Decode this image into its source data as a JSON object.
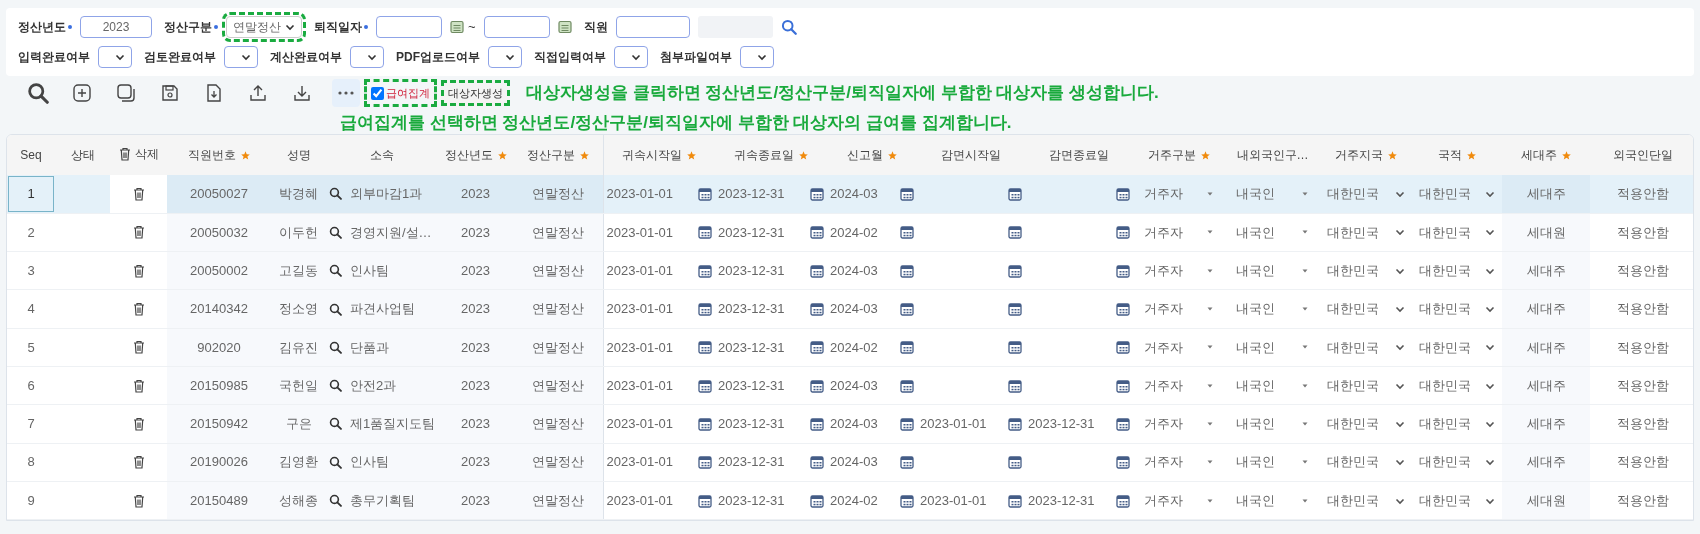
{
  "filters": [
    {
      "label": "정산년도",
      "required": true,
      "kind": "text",
      "value": "2023",
      "highlighted": false
    },
    {
      "label": "정산구분",
      "required": true,
      "kind": "select",
      "value": "연말정산",
      "highlighted": true
    },
    {
      "label": "퇴직일자",
      "required": true,
      "kind": "daterange",
      "separator": "~",
      "highlighted": false
    },
    {
      "label": "직원",
      "required": false,
      "kind": "employee",
      "highlighted": false
    }
  ],
  "status_filters": [
    {
      "label": "입력완료여부"
    },
    {
      "label": "검토완료여부"
    },
    {
      "label": "계산완료여부"
    },
    {
      "label": "PDF업로드여부"
    },
    {
      "label": "직접입력여부"
    },
    {
      "label": "첨부파일여부"
    }
  ],
  "toolbar": {
    "tools": [
      {
        "kind": "search"
      },
      {
        "kind": "add"
      },
      {
        "kind": "copy"
      },
      {
        "kind": "save"
      },
      {
        "kind": "import"
      },
      {
        "kind": "upload"
      },
      {
        "kind": "download"
      },
      {
        "kind": "more"
      }
    ],
    "payroll_sum": {
      "label": "급여집계",
      "checked": true,
      "highlighted": true
    },
    "create_button": {
      "label": "대상자생성",
      "highlighted": true
    }
  },
  "notes": [
    "대상자생성을 클릭하면 정산년도/정산구분/퇴직일자에 부합한 대상자를 생성합니다.",
    "급여집계를 선택하면 정산년도/정산구분/퇴직일자에 부합한 대상자의 급여를 집계합니다."
  ],
  "table": {
    "columns": [
      {
        "label": "Seq",
        "kind": "seq",
        "required": false
      },
      {
        "label": "상태",
        "kind": "status",
        "required": false
      },
      {
        "label": "삭제",
        "kind": "delete",
        "required": false
      },
      {
        "label": "직원번호",
        "kind": "text",
        "required": true
      },
      {
        "label": "성명",
        "kind": "text",
        "required": false
      },
      {
        "label": "소속",
        "kind": "lookup",
        "required": false
      },
      {
        "label": "정산년도",
        "kind": "text",
        "required": true
      },
      {
        "label": "정산구분",
        "kind": "text",
        "required": true
      },
      {
        "label": "귀속시작일",
        "kind": "date",
        "required": true
      },
      {
        "label": "귀속종료일",
        "kind": "date",
        "required": true
      },
      {
        "label": "신고월",
        "kind": "date",
        "required": true
      },
      {
        "label": "감면시작일",
        "kind": "date",
        "required": false
      },
      {
        "label": "감면종료일",
        "kind": "date",
        "required": false
      },
      {
        "label": "거주구분",
        "kind": "select",
        "required": true
      },
      {
        "label": "내외국인구…",
        "kind": "select",
        "required": false
      },
      {
        "label": "거주지국",
        "kind": "combo",
        "required": true
      },
      {
        "label": "국적",
        "kind": "combo",
        "required": true
      },
      {
        "label": "세대주",
        "kind": "shaded",
        "required": true
      },
      {
        "label": "외국인단일",
        "kind": "text",
        "required": false
      }
    ],
    "rows": [
      {
        "selected": true,
        "cells": [
          "1",
          "",
          "",
          "20050027",
          "박경혜",
          "외부마감1과",
          "2023",
          "연말정산",
          "2023-01-01",
          "2023-12-31",
          "2024-03",
          null,
          null,
          "거주자",
          "내국인",
          "대한민국",
          "대한민국",
          "세대주",
          "적용안함"
        ]
      },
      {
        "selected": false,
        "cells": [
          "2",
          "",
          "",
          "20050032",
          "이두헌",
          "경영지원/설…",
          "2023",
          "연말정산",
          "2023-01-01",
          "2023-12-31",
          "2024-02",
          null,
          null,
          "거주자",
          "내국인",
          "대한민국",
          "대한민국",
          "세대원",
          "적용안함"
        ]
      },
      {
        "selected": false,
        "cells": [
          "3",
          "",
          "",
          "20050002",
          "고길동",
          "인사팀",
          "2023",
          "연말정산",
          "2023-01-01",
          "2023-12-31",
          "2024-03",
          null,
          null,
          "거주자",
          "내국인",
          "대한민국",
          "대한민국",
          "세대주",
          "적용안함"
        ]
      },
      {
        "selected": false,
        "cells": [
          "4",
          "",
          "",
          "20140342",
          "정소영",
          "파견사업팀",
          "2023",
          "연말정산",
          "2023-01-01",
          "2023-12-31",
          "2024-03",
          null,
          null,
          "거주자",
          "내국인",
          "대한민국",
          "대한민국",
          "세대주",
          "적용안함"
        ]
      },
      {
        "selected": false,
        "cells": [
          "5",
          "",
          "",
          "902020",
          "김유진",
          "단품과",
          "2023",
          "연말정산",
          "2023-01-01",
          "2023-12-31",
          "2024-02",
          null,
          null,
          "거주자",
          "내국인",
          "대한민국",
          "대한민국",
          "세대주",
          "적용안함"
        ]
      },
      {
        "selected": false,
        "cells": [
          "6",
          "",
          "",
          "20150985",
          "국헌일",
          "안전2과",
          "2023",
          "연말정산",
          "2023-01-01",
          "2023-12-31",
          "2024-03",
          null,
          null,
          "거주자",
          "내국인",
          "대한민국",
          "대한민국",
          "세대주",
          "적용안함"
        ]
      },
      {
        "selected": false,
        "cells": [
          "7",
          "",
          "",
          "20150942",
          "구은",
          "제1품질지도팀",
          "2023",
          "연말정산",
          "2023-01-01",
          "2023-12-31",
          "2024-03",
          "2023-01-01",
          "2023-12-31",
          "거주자",
          "내국인",
          "대한민국",
          "대한민국",
          "세대주",
          "적용안함"
        ]
      },
      {
        "selected": false,
        "cells": [
          "8",
          "",
          "",
          "20190026",
          "김영환",
          "인사팀",
          "2023",
          "연말정산",
          "2023-01-01",
          "2023-12-31",
          "2024-03",
          null,
          null,
          "거주자",
          "내국인",
          "대한민국",
          "대한민국",
          "세대주",
          "적용안함"
        ]
      },
      {
        "selected": false,
        "cells": [
          "9",
          "",
          "",
          "20150489",
          "성해종",
          "총무기획팀",
          "2023",
          "연말정산",
          "2023-01-01",
          "2023-12-31",
          "2024-02",
          "2023-01-01",
          "2023-12-31",
          "거주자",
          "내국인",
          "대한민국",
          "대한민국",
          "세대원",
          "적용안함"
        ]
      }
    ]
  }
}
